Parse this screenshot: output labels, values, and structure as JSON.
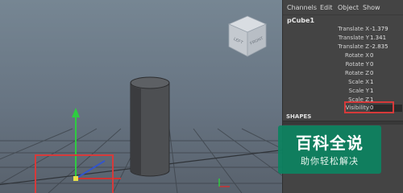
{
  "channel_box": {
    "menu": [
      {
        "label": "Channels"
      },
      {
        "label": "Edit"
      },
      {
        "label": "Object"
      },
      {
        "label": "Show"
      }
    ],
    "object_name": "pCube1",
    "attributes": [
      {
        "label": "Translate X",
        "value": "-1.379"
      },
      {
        "label": "Translate Y",
        "value": "1.341"
      },
      {
        "label": "Translate Z",
        "value": "-2.835"
      },
      {
        "label": "Rotate X",
        "value": "0"
      },
      {
        "label": "Rotate Y",
        "value": "0"
      },
      {
        "label": "Rotate Z",
        "value": "0"
      },
      {
        "label": "Scale X",
        "value": "1"
      },
      {
        "label": "Scale Y",
        "value": "1"
      },
      {
        "label": "Scale Z",
        "value": "1"
      },
      {
        "label": "Visibility",
        "value": "0"
      }
    ],
    "shapes_header": "SHAPES"
  },
  "viewcube": {
    "left_face": "LEFT",
    "front_face": "FRONT"
  },
  "watermark": {
    "title": "百科全说",
    "subtitle": "助你轻松解决"
  },
  "colors": {
    "highlight": "#d63a3a",
    "watermark_bg": "#0c8260",
    "y_axis": "#2ecc40"
  }
}
